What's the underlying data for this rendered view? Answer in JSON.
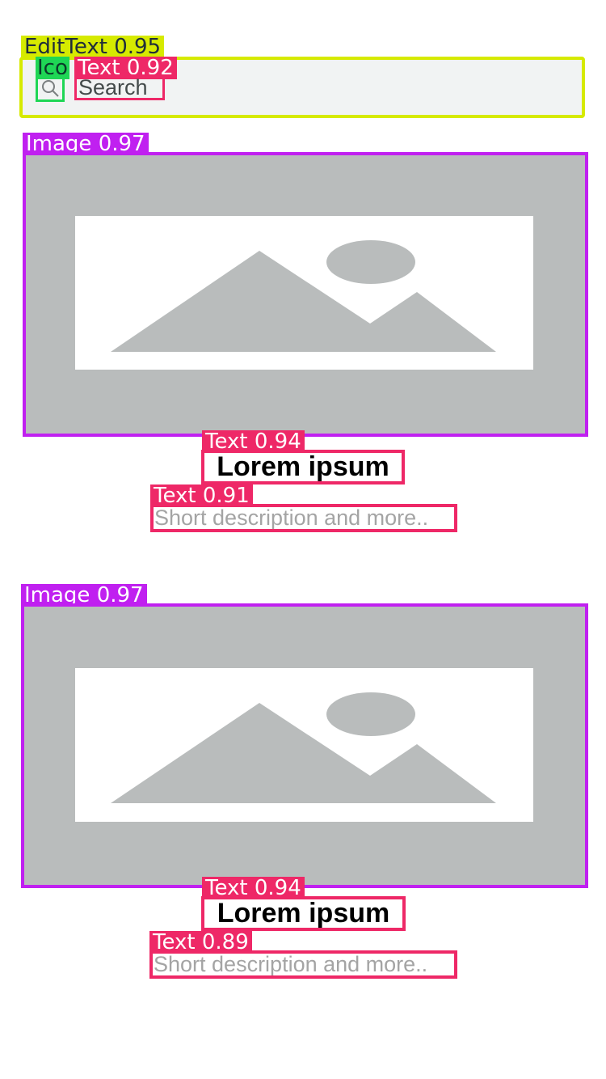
{
  "annotations": {
    "edittext_label": "EditText  0.95",
    "icon_label": "Ico",
    "search_text_label": "Text  0.92",
    "image1_label": "Image  0.97",
    "title1_label": "Text  0.94",
    "desc1_label": "Text  0.91",
    "image2_label": "Image  0.97",
    "title2_label": "Text  0.94",
    "desc2_label": "Text  0.89"
  },
  "colors": {
    "edittext": "#d6ea00",
    "icon": "#1fd655",
    "text": "#ee2867",
    "image": "#c020f0",
    "placeholder_bg": "#b9bcbc",
    "search_bg": "#f1f3f3"
  },
  "search": {
    "placeholder": "Search",
    "icon": "search-icon"
  },
  "cards": [
    {
      "title": "Lorem ipsum",
      "description": "Short description and more..",
      "image_icon": "image-placeholder-icon"
    },
    {
      "title": "Lorem ipsum",
      "description": "Short description and more..",
      "image_icon": "image-placeholder-icon"
    }
  ]
}
